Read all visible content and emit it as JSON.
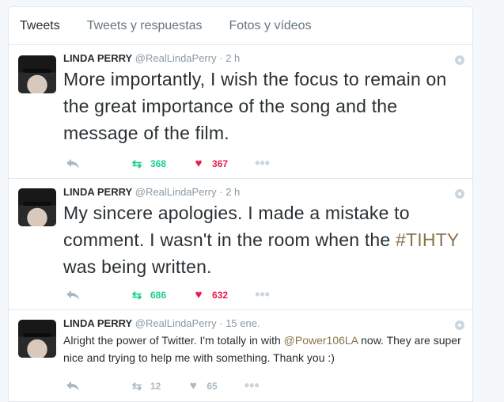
{
  "tabs": [
    "Tweets",
    "Tweets y respuestas",
    "Fotos y vídeos"
  ],
  "tweets": [
    {
      "name": "LINDA PERRY",
      "handle": "@RealLindaPerry",
      "dot": "·",
      "time": "2 h",
      "text": "More importantly, I wish the focus to remain on the great importance of the song and the message of the film.",
      "retweets": "368",
      "likes": "367"
    },
    {
      "name": "LINDA PERRY",
      "handle": "@RealLindaPerry",
      "dot": "·",
      "time": "2 h",
      "text_before": "My sincere apologies. I made a mistake to comment. I wasn't in the room when the ",
      "hashtag": "#TIHTY",
      "text_after": " was being written.",
      "retweets": "686",
      "likes": "632"
    },
    {
      "name": "LINDA PERRY",
      "handle": "@RealLindaPerry",
      "dot": "·",
      "time": "15 ene.",
      "text_before": "Alright the power of Twitter. I'm totally in with ",
      "mention": "@Power106LA",
      "text_after": " now. They are super nice and trying to help me with something. Thank you :)",
      "retweets": "12",
      "likes": "65"
    }
  ],
  "icons": {
    "reply": "reply-icon",
    "retweet": "retweet-icon",
    "like": "heart-icon",
    "more": "more-icon",
    "caret": "caret-icon"
  },
  "colors": {
    "retweet": "#19cf86",
    "like": "#e81c4f",
    "link": "#8b7348"
  }
}
